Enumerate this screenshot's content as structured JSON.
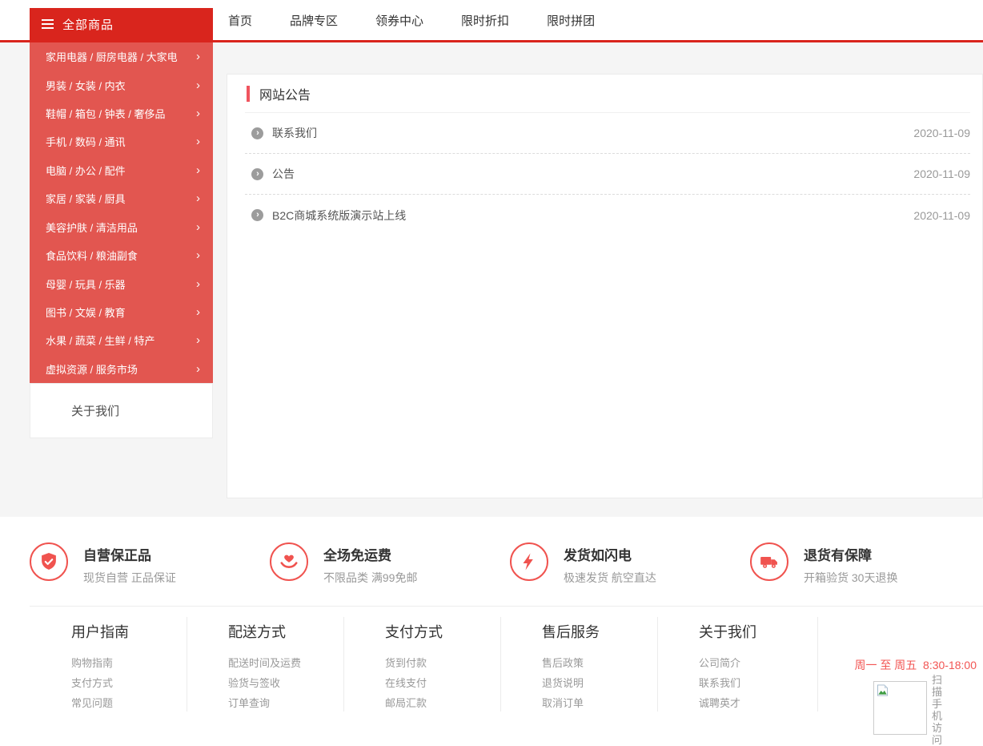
{
  "colors": {
    "primary_dark_red": "#d9251d",
    "sidebar_red": "#e25650",
    "accent_salmon": "#f0534f",
    "page_background": "#f5f5f5",
    "text_dark": "#333333",
    "text_gray": "#999999"
  },
  "header": {
    "all_products_label": "全部商品",
    "nav": [
      {
        "label": "首页"
      },
      {
        "label": "品牌专区"
      },
      {
        "label": "领券中心"
      },
      {
        "label": "限时折扣"
      },
      {
        "label": "限时拼团"
      }
    ]
  },
  "sidebar": {
    "chevron": "›",
    "categories": [
      {
        "label": "家用电器 / 厨房电器 / 大家电"
      },
      {
        "label": "男装 / 女装 / 内衣"
      },
      {
        "label": "鞋帽 / 箱包 / 钟表 / 奢侈品"
      },
      {
        "label": "手机 / 数码 / 通讯"
      },
      {
        "label": "电脑 / 办公 / 配件"
      },
      {
        "label": "家居 / 家装 / 厨具"
      },
      {
        "label": "美容护肤 / 清洁用品"
      },
      {
        "label": "食品饮料 / 粮油副食"
      },
      {
        "label": "母婴 / 玩具 / 乐器"
      },
      {
        "label": "图书 / 文娱 / 教育"
      },
      {
        "label": "水果 / 蔬菜 / 生鲜 / 特产"
      },
      {
        "label": "虚拟资源 / 服务市场"
      }
    ],
    "about_label": "关于我们"
  },
  "announcements": {
    "title": "网站公告",
    "item_chevron": "›",
    "items": [
      {
        "text": "联系我们",
        "date": "2020-11-09"
      },
      {
        "text": "公告",
        "date": "2020-11-09"
      },
      {
        "text": "B2C商城系统版演示站上线",
        "date": "2020-11-09"
      }
    ]
  },
  "features": [
    {
      "icon": "shield-check-icon",
      "title": "自营保正品",
      "subtitle": "现货自营 正品保证"
    },
    {
      "icon": "heart-hands-icon",
      "title": "全场免运费",
      "subtitle": "不限品类 满99免邮"
    },
    {
      "icon": "lightning-icon",
      "title": "发货如闪电",
      "subtitle": "极速发货 航空直达"
    },
    {
      "icon": "truck-icon",
      "title": "退货有保障",
      "subtitle": "开箱验货 30天退换"
    }
  ],
  "footer": {
    "columns": [
      {
        "title": "用户指南",
        "links": [
          "购物指南",
          "支付方式",
          "常见问题"
        ]
      },
      {
        "title": "配送方式",
        "links": [
          "配送时间及运费",
          "验货与签收",
          "订单查询"
        ]
      },
      {
        "title": "支付方式",
        "links": [
          "货到付款",
          "在线支付",
          "邮局汇款"
        ]
      },
      {
        "title": "售后服务",
        "links": [
          "售后政策",
          "退货说明",
          "取消订单"
        ]
      },
      {
        "title": "关于我们",
        "links": [
          "公司简介",
          "联系我们",
          "诚聘英才"
        ]
      }
    ],
    "service_time": "周一 至 周五  8:30-18:00",
    "qr_caption": "扫描手机访问"
  }
}
